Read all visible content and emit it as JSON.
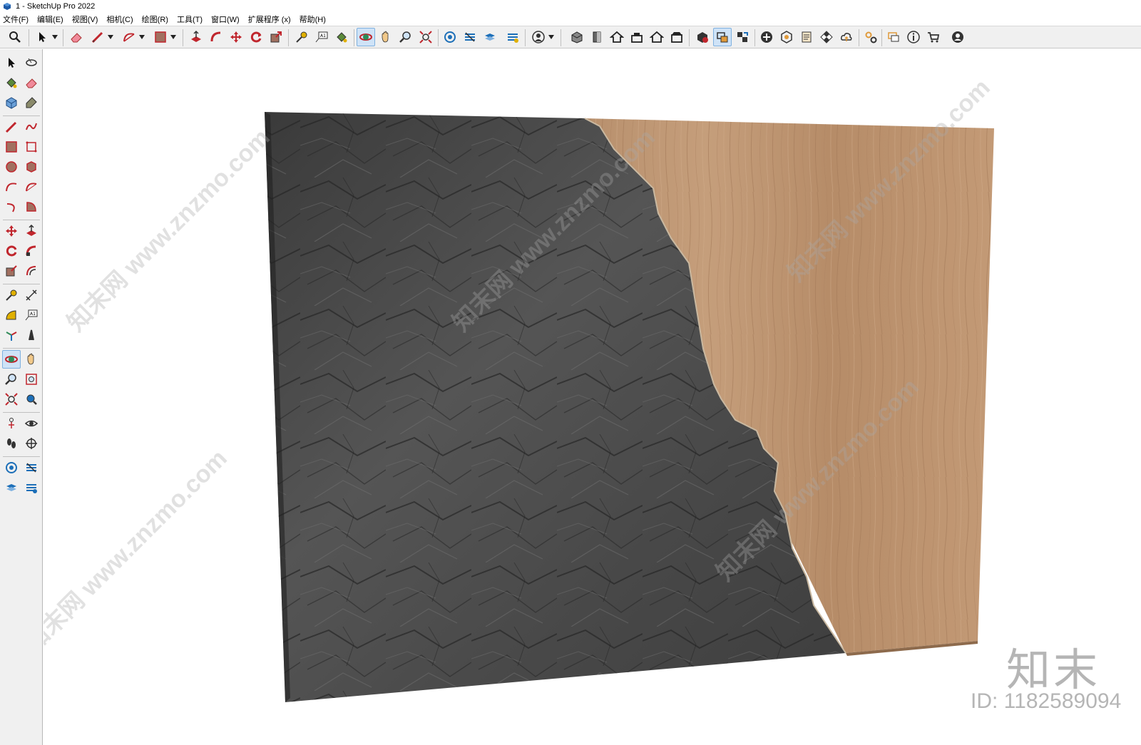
{
  "window": {
    "title": "1 - SketchUp Pro 2022"
  },
  "menu": {
    "items": [
      "文件(F)",
      "编辑(E)",
      "视图(V)",
      "相机(C)",
      "绘图(R)",
      "工具(T)",
      "窗口(W)",
      "扩展程序 (x)",
      "帮助(H)"
    ]
  },
  "toolbar_top": {
    "icons": [
      "search-icon",
      "select-icon",
      "eraser-icon",
      "pencil-line-icon",
      "arc-icon",
      "rectangle-icon",
      "push-pull-icon",
      "follow-me-icon",
      "move-icon",
      "rotate-icon",
      "scale-icon",
      "tape-measure-icon",
      "text-label-icon",
      "paint-bucket-icon",
      "orbit-icon",
      "pan-icon",
      "zoom-icon",
      "zoom-extents-icon",
      "section-plane-icon",
      "section-display-icon",
      "section-cut-icon",
      "section-fill-icon",
      "user-icon",
      "warehouse-icon",
      "iso-view-icon",
      "top-view-icon",
      "front-view-icon",
      "right-view-icon",
      "back-view-icon",
      "left-view-icon",
      "extension-warehouse-icon",
      "style-icon",
      "layout-icon",
      "add-icon",
      "trimble-connect-icon",
      "model-info-icon",
      "checker-icon",
      "cloud-icon",
      "settings-icon",
      "message-icon",
      "info-icon",
      "cart-icon",
      "account-icon"
    ]
  },
  "toolbar_left": {
    "icons": [
      "select-icon",
      "orbit-small-icon",
      "paint-bucket-icon",
      "eraser-icon",
      "component-icon",
      "tag-icon",
      "line-icon",
      "freehand-icon",
      "rectangle-icon",
      "rotated-rectangle-icon",
      "circle-icon",
      "polygon-icon",
      "arc-icon",
      "two-point-arc-icon",
      "three-point-arc-icon",
      "pie-icon",
      "move-icon",
      "push-pull-icon",
      "rotate-icon",
      "follow-me-icon",
      "scale-icon",
      "offset-icon",
      "tape-measure-icon",
      "dimension-icon",
      "protractor-icon",
      "text-icon",
      "axes-icon",
      "3d-text-icon",
      "orbit-icon",
      "pan-icon",
      "zoom-icon",
      "zoom-window-icon",
      "zoom-extents-icon",
      "previous-view-icon",
      "position-camera-icon",
      "look-around-icon",
      "walk-icon",
      "section-plane-icon",
      "section-plane-2-icon",
      "section-display-icon",
      "section-cut-icon",
      "section-fill-icon"
    ]
  },
  "watermark": {
    "text": "知末网 www.znzmo.com",
    "logo": "知末",
    "id": "ID: 1182589094"
  },
  "colors": {
    "toolbar_bg": "#f0f0f0",
    "active_tool": "#cfe3f7",
    "rock_dark": "#3c3c3c",
    "rock_mid": "#5a5a5a",
    "wood": "#b98e69",
    "wood_light": "#c9a07c"
  }
}
